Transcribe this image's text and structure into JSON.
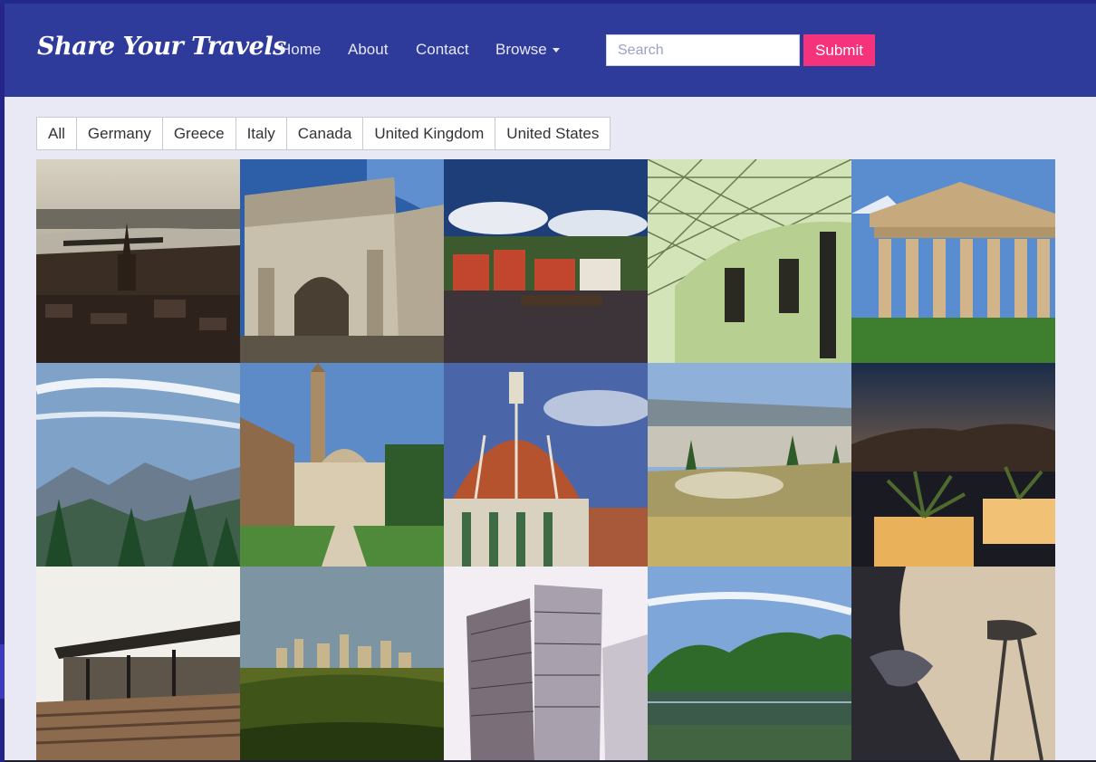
{
  "brand": "Share Your Travels",
  "nav": {
    "home": "Home",
    "about": "About",
    "contact": "Contact",
    "browse": "Browse"
  },
  "search": {
    "placeholder": "Search",
    "submit": "Submit"
  },
  "filters": [
    "All",
    "Germany",
    "Greece",
    "Italy",
    "Canada",
    "United Kingdom",
    "United States"
  ],
  "colors": {
    "navbar": "#2f3b9b",
    "submit": "#f5327c",
    "page_bg": "#e8e9f4"
  },
  "photos": [
    "cologne-river-city",
    "roman-triumphal-arch",
    "harbor-red-houses",
    "british-museum-great-court",
    "greek-temple",
    "alpine-valley",
    "florence-basilica-courtyard",
    "florence-cathedral-dome",
    "athens-ancient-ruins",
    "santorini-terrace-planters",
    "neue-nationalgalerie",
    "calgary-skyline",
    "glass-office-towers",
    "park-lake",
    "seattle-space-needle"
  ]
}
